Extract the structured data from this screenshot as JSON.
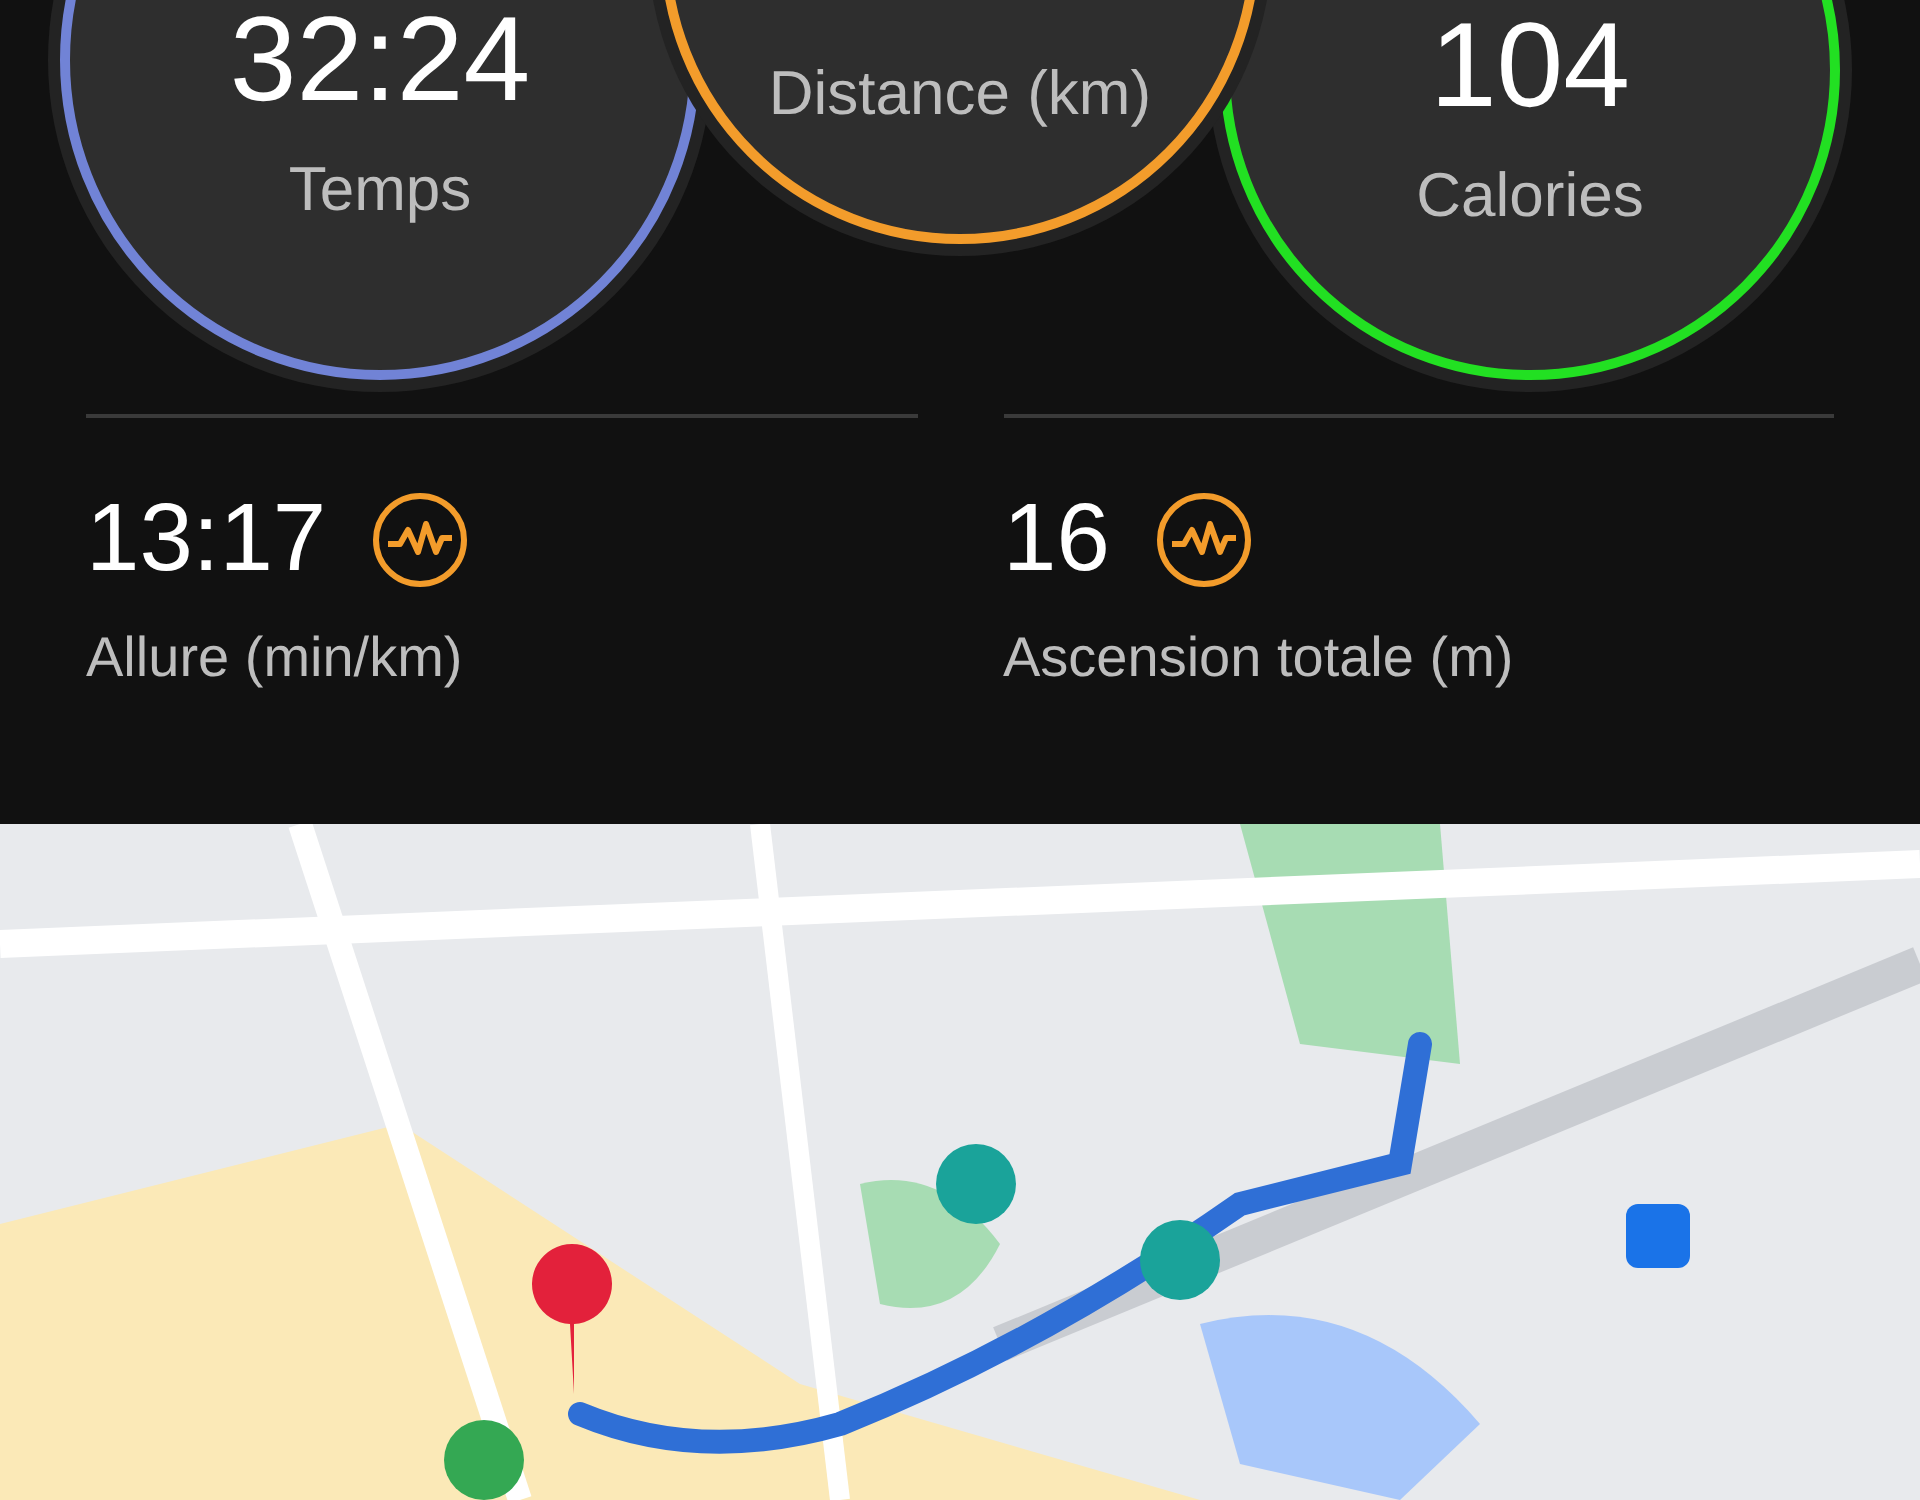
{
  "rings": [
    {
      "value": "32:24",
      "label": "Temps",
      "color": "#7183d6"
    },
    {
      "label": "Distance (km)",
      "color": "#f39c2b"
    },
    {
      "value": "104",
      "label": "Calories",
      "color": "#22e022"
    }
  ],
  "stats": [
    {
      "value": "13:17",
      "label": "Allure (min/km)"
    },
    {
      "value": "16",
      "label": "Ascension totale (m)"
    }
  ]
}
